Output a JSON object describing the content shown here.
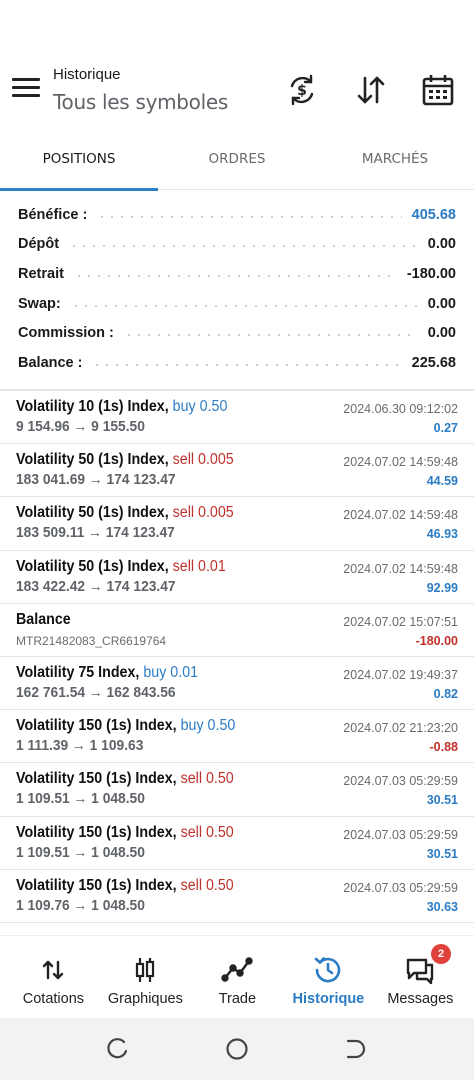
{
  "header": {
    "title": "Historique",
    "subtitle": "Tous les symboles",
    "icons": [
      "menu-icon",
      "currency-exchange-icon",
      "sort-icon",
      "calendar-icon"
    ]
  },
  "tabs": [
    {
      "label": "POSITIONS",
      "active": true
    },
    {
      "label": "ORDRES",
      "active": false
    },
    {
      "label": "MARCHÉS",
      "active": false
    }
  ],
  "summary": [
    {
      "label": "Bénéfice :",
      "value": "405.68",
      "highlight": true
    },
    {
      "label": "Dépôt",
      "value": "0.00",
      "highlight": false
    },
    {
      "label": "Retrait",
      "value": "-180.00",
      "highlight": false
    },
    {
      "label": "Swap:",
      "value": "0.00",
      "highlight": false
    },
    {
      "label": "Commission :",
      "value": "0.00",
      "highlight": false
    },
    {
      "label": "Balance :",
      "value": "225.68",
      "highlight": false
    }
  ],
  "deals": [
    {
      "symbol": "Volatility 10 (1s) Index,",
      "direction": "buy",
      "volume": "0.50",
      "prices": "9 154.96 → 9 155.50",
      "time": "2024.06.30 09:12:02",
      "profit": "0.27",
      "negative": false
    },
    {
      "symbol": "Volatility 50 (1s) Index,",
      "direction": "sell",
      "volume": "0.005",
      "prices": "183 041.69 → 174 123.47",
      "time": "2024.07.02 14:59:48",
      "profit": "44.59",
      "negative": false
    },
    {
      "symbol": "Volatility 50 (1s) Index,",
      "direction": "sell",
      "volume": "0.005",
      "prices": "183 509.11 → 174 123.47",
      "time": "2024.07.02 14:59:48",
      "profit": "46.93",
      "negative": false
    },
    {
      "symbol": "Volatility 50 (1s) Index,",
      "direction": "sell",
      "volume": "0.01",
      "prices": "183 422.42 → 174 123.47",
      "time": "2024.07.02 14:59:48",
      "profit": "92.99",
      "negative": false
    },
    {
      "symbol": "Balance",
      "direction": "",
      "volume": "",
      "comment": "MTR21482083_CR6619764",
      "time": "2024.07.02 15:07:51",
      "profit": "-180.00",
      "negative": true
    },
    {
      "symbol": "Volatility 75 Index,",
      "direction": "buy",
      "volume": "0.01",
      "prices": "162 761.54 → 162 843.56",
      "time": "2024.07.02 19:49:37",
      "profit": "0.82",
      "negative": false
    },
    {
      "symbol": "Volatility 150 (1s) Index,",
      "direction": "buy",
      "volume": "0.50",
      "prices": "1 111.39 → 1 109.63",
      "time": "2024.07.02 21:23:20",
      "profit": "-0.88",
      "negative": true
    },
    {
      "symbol": "Volatility 150 (1s) Index,",
      "direction": "sell",
      "volume": "0.50",
      "prices": "1 109.51 → 1 048.50",
      "time": "2024.07.03 05:29:59",
      "profit": "30.51",
      "negative": false
    },
    {
      "symbol": "Volatility 150 (1s) Index,",
      "direction": "sell",
      "volume": "0.50",
      "prices": "1 109.51 → 1 048.50",
      "time": "2024.07.03 05:29:59",
      "profit": "30.51",
      "negative": false
    },
    {
      "symbol": "Volatility 150 (1s) Index,",
      "direction": "sell",
      "volume": "0.50",
      "prices": "1 109.76 → 1 048.50",
      "time": "2024.07.03 05:29:59",
      "profit": "30.63",
      "negative": false
    }
  ],
  "nav": [
    {
      "label": "Cotations",
      "icon": "quotes-icon",
      "active": false
    },
    {
      "label": "Graphiques",
      "icon": "chart-icon",
      "active": false
    },
    {
      "label": "Trade",
      "icon": "trade-icon",
      "active": false
    },
    {
      "label": "Historique",
      "icon": "history-icon",
      "active": true
    },
    {
      "label": "Messages",
      "icon": "messages-icon",
      "active": false,
      "badge": "2"
    }
  ],
  "colors": {
    "accent": "#2b7cc4",
    "sell": "#c0302b",
    "badge": "#e0413b"
  }
}
